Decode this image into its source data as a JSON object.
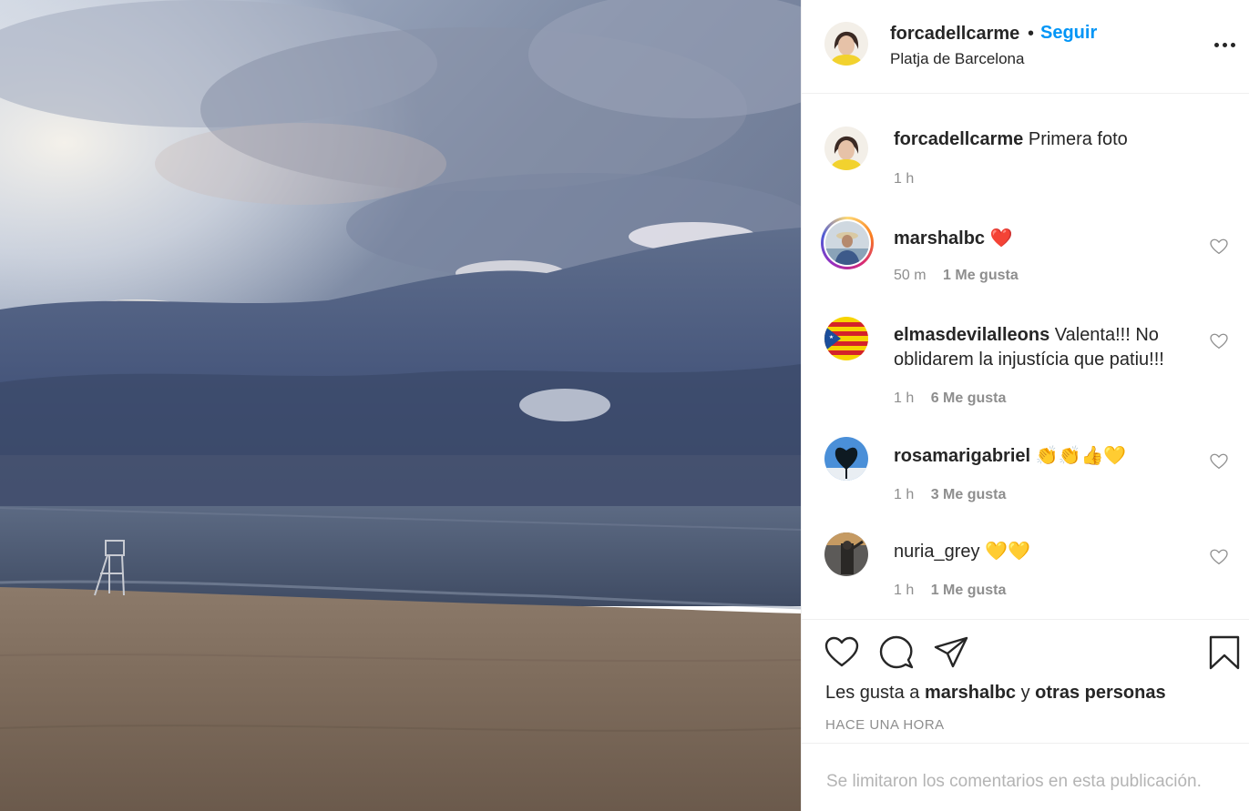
{
  "post": {
    "photo_alt": "photo-beach-storm",
    "author": "forcadellcarme",
    "follow_label": "Seguir",
    "separator": "•",
    "location": "Platja de Barcelona",
    "more_icon": "more-horizontal-icon"
  },
  "caption": {
    "user": "forcadellcarme",
    "text": "Primera foto",
    "time": "1 h"
  },
  "comments": [
    {
      "user": "marshalbc",
      "text": "❤️",
      "time": "50 m",
      "likes": "1 Me gusta",
      "has_story": true
    },
    {
      "user": "elmasdevilalleons",
      "text": "Valenta!!! No oblidarem la injustícia que patiu!!!",
      "time": "1 h",
      "likes": "6 Me gusta",
      "has_story": false
    },
    {
      "user": "rosamarigabriel",
      "text": "👏👏👍💛",
      "time": "1 h",
      "likes": "3 Me gusta",
      "has_story": false
    },
    {
      "user": "nuria_grey",
      "text": "💛💛",
      "time": "1 h",
      "likes": "1 Me gusta",
      "has_story": false
    }
  ],
  "actions": {
    "like_icon": "heart-icon",
    "comment_icon": "comment-icon",
    "share_icon": "share-icon",
    "save_icon": "bookmark-icon"
  },
  "liked_by": {
    "prefix": "Les gusta a",
    "user": "marshalbc",
    "conj": "y",
    "others": "otras personas"
  },
  "timestamp": "HACE UNA HORA",
  "comments_limited": "Se limitaron los comentarios en esta publicación.",
  "colors": {
    "link_blue": "#0095f6",
    "text": "#262626",
    "secondary": "#8e8e8e",
    "border": "#efefef"
  }
}
